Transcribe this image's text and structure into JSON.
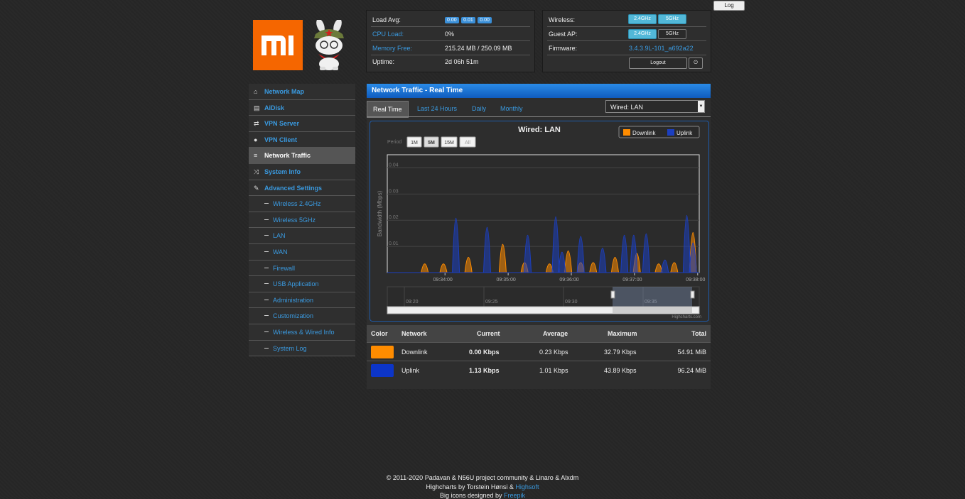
{
  "top": {
    "log_button": "Log"
  },
  "status": {
    "load_label": "Load Avg:",
    "load_values": [
      "0.00",
      "0.01",
      "0.00"
    ],
    "cpu_label": "CPU Load:",
    "cpu_value": "0%",
    "mem_label": "Memory Free:",
    "mem_value": "215.24 MB / 250.09 MB",
    "uptime_label": "Uptime:",
    "uptime_value": "2d 06h 51m"
  },
  "wireless": {
    "wireless_label": "Wireless:",
    "guest_label": "Guest AP:",
    "firmware_label": "Firmware:",
    "firmware_value": "3.4.3.9L-101_a692a22",
    "btn_24": "2.4GHz",
    "btn_5": "5GHz",
    "logout": "Logout"
  },
  "menu": [
    {
      "label": "Network Map",
      "icon": "home-icon",
      "sub": false,
      "active": false
    },
    {
      "label": "AiDisk",
      "icon": "disk-icon",
      "sub": false,
      "active": false
    },
    {
      "label": "VPN Server",
      "icon": "retweet-icon",
      "sub": false,
      "active": false
    },
    {
      "label": "VPN Client",
      "icon": "globe-icon",
      "sub": false,
      "active": false
    },
    {
      "label": "Network Traffic",
      "icon": "list-icon",
      "sub": false,
      "active": true
    },
    {
      "label": "System Info",
      "icon": "random-icon",
      "sub": false,
      "active": false
    },
    {
      "label": "Advanced Settings",
      "icon": "wrench-icon",
      "sub": false,
      "active": false
    },
    {
      "label": "Wireless 2.4GHz",
      "sub": true
    },
    {
      "label": "Wireless 5GHz",
      "sub": true
    },
    {
      "label": "LAN",
      "sub": true
    },
    {
      "label": "WAN",
      "sub": true
    },
    {
      "label": "Firewall",
      "sub": true
    },
    {
      "label": "USB Application",
      "sub": true
    },
    {
      "label": "Administration",
      "sub": true
    },
    {
      "label": "Customization",
      "sub": true
    },
    {
      "label": "Wireless & Wired Info",
      "sub": true
    },
    {
      "label": "System Log",
      "sub": true
    }
  ],
  "main": {
    "header": "Network Traffic - Real Time",
    "tabs": [
      "Real Time",
      "Last 24 Hours",
      "Daily",
      "Monthly"
    ],
    "select_value": "Wired: LAN"
  },
  "chart_data": {
    "type": "area",
    "title": "Wired: LAN",
    "ylabel": "Bandwidth (Mbps)",
    "ylim": [
      0,
      0.045
    ],
    "yticks": [
      "0.01",
      "0.02",
      "0.03",
      "0.04"
    ],
    "xticks": [
      "09:34:00",
      "09:35:00",
      "09:36:00",
      "09:37:00",
      "09:38:00"
    ],
    "legend_position": "top-right",
    "period_label": "Period",
    "period_buttons": [
      "1M",
      "5M",
      "15M",
      "All"
    ],
    "period_selected": "5M",
    "navigator_ticks": [
      "09:20",
      "09:25",
      "09:30",
      "09:35"
    ],
    "credits": "Highcharts.com",
    "series": [
      {
        "name": "Downlink",
        "color": "#ff8c00",
        "peaks": [
          [
            0.12,
            0.005
          ],
          [
            0.18,
            0.005
          ],
          [
            0.26,
            0.01
          ],
          [
            0.37,
            0.02
          ],
          [
            0.44,
            0.006
          ],
          [
            0.52,
            0.005
          ],
          [
            0.58,
            0.015
          ],
          [
            0.62,
            0.006
          ],
          [
            0.66,
            0.006
          ],
          [
            0.73,
            0.01
          ],
          [
            0.8,
            0.013
          ],
          [
            0.87,
            0.005
          ],
          [
            0.92,
            0.006
          ],
          [
            0.98,
            0.029
          ]
        ]
      },
      {
        "name": "Uplink",
        "color": "#1c3fc0",
        "peaks": [
          [
            0.22,
            0.04
          ],
          [
            0.32,
            0.033
          ],
          [
            0.45,
            0.027
          ],
          [
            0.54,
            0.041
          ],
          [
            0.56,
            0.014
          ],
          [
            0.62,
            0.026
          ],
          [
            0.69,
            0.017
          ],
          [
            0.76,
            0.027
          ],
          [
            0.79,
            0.027
          ],
          [
            0.83,
            0.028
          ],
          [
            0.89,
            0.008
          ],
          [
            0.96,
            0.042
          ],
          [
            0.98,
            0.021
          ]
        ]
      }
    ]
  },
  "table": {
    "headers": [
      "Color",
      "Network",
      "Current",
      "Average",
      "Maximum",
      "Total"
    ],
    "rows": [
      {
        "color": "#ff8c00",
        "network": "Downlink",
        "current": "0.00 Kbps",
        "average": "0.23 Kbps",
        "maximum": "32.79 Kbps",
        "total": "54.91 MiB"
      },
      {
        "color": "#0c35c8",
        "network": "Uplink",
        "current": "1.13 Kbps",
        "average": "1.01 Kbps",
        "maximum": "43.89 Kbps",
        "total": "96.24 MiB"
      }
    ]
  },
  "footer": {
    "line1": "© 2011-2020 Padavan & N56U project community & Linaro & Alxdm",
    "line2_pre": "Highcharts by Torstein Hønsi & ",
    "line2_link": "Highsoft",
    "line3_pre": "Big icons designed by ",
    "line3_link": "Freepik"
  }
}
